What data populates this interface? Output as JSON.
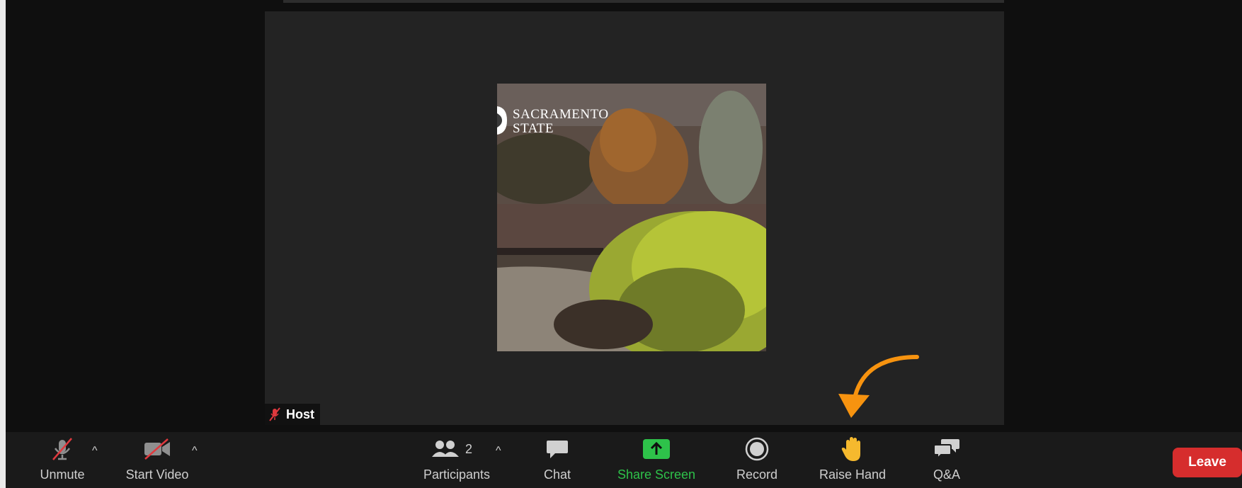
{
  "video": {
    "brand_line1": "SACRAMENTO",
    "brand_line2": "STATE",
    "host_label": "Host"
  },
  "toolbar": {
    "unmute_label": "Unmute",
    "start_video_label": "Start Video",
    "participants_label": "Participants",
    "participants_count": "2",
    "chat_label": "Chat",
    "share_screen_label": "Share Screen",
    "record_label": "Record",
    "raise_hand_label": "Raise Hand",
    "qa_label": "Q&A",
    "leave_label": "Leave"
  },
  "icons": {
    "mic": "mic-off-icon",
    "video": "video-off-icon",
    "participants": "people-icon",
    "chat": "chat-bubble-icon",
    "share": "share-screen-icon",
    "record": "record-icon",
    "raise_hand": "raise-hand-icon",
    "qa": "qa-bubbles-icon",
    "annotation": "arrow-annotation-icon"
  },
  "colors": {
    "leave": "#d62d2d",
    "share_screen": "#2ec24a",
    "annotation_arrow": "#f7930f",
    "mute_slash": "#e0393e"
  }
}
